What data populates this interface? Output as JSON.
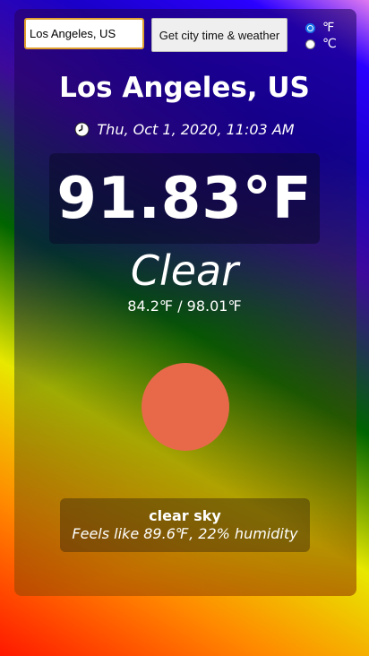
{
  "search": {
    "value": "Los Angeles, US",
    "button_label": "Get city time & weather"
  },
  "units": {
    "fahrenheit_label": "℉",
    "celsius_label": "℃",
    "selected": "fahrenheit"
  },
  "weather": {
    "city": "Los Angeles, US",
    "datetime": "Thu, Oct 1, 2020, 11:03 AM",
    "temperature": "91.83°F",
    "condition": "Clear",
    "range": "84.2℉ / 98.01℉",
    "description": "clear sky",
    "details": "Feels like 89.6℉, 22% humidity"
  },
  "colors": {
    "sun": "#e8694a",
    "input_border": "#e0a030"
  },
  "icons": {
    "clock": "clock-icon",
    "sun": "sun-icon"
  }
}
